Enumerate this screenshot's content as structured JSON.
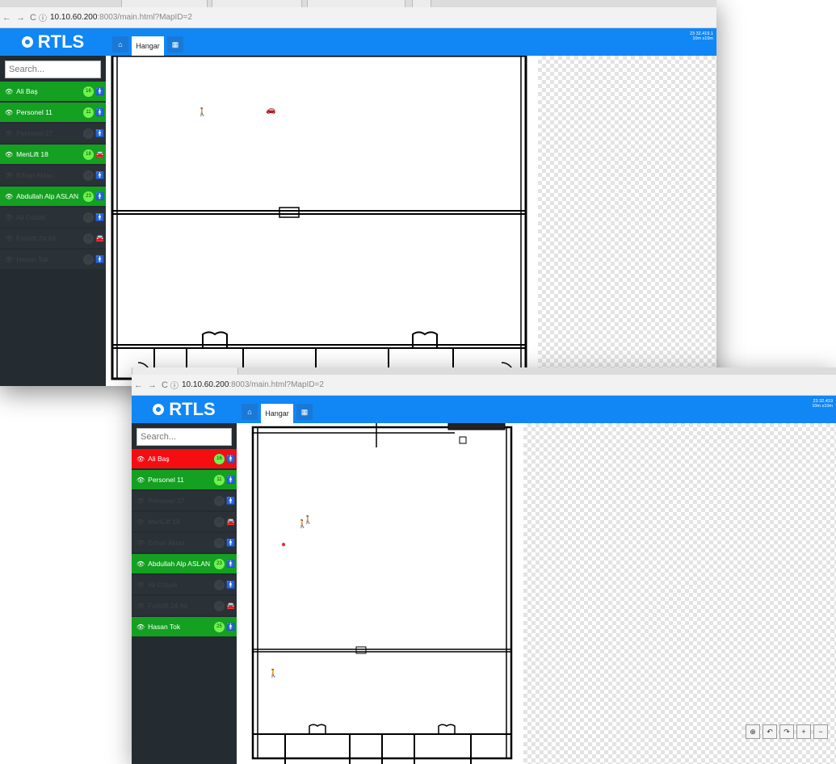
{
  "window1": {
    "url_host": "10.10.60.200",
    "url_path": ":8003/main.html?MapID=2",
    "brand": "RTLS",
    "search_placeholder": "Search...",
    "tab_home_icon": "home-icon",
    "tab_label": "Hangar",
    "tab_map_icon": "map-icon",
    "coords_line1": "23 32.419.1",
    "coords_line2": "10m x10m",
    "items": [
      {
        "name": "Ali Baş",
        "badge": "16",
        "state": "green",
        "icon": "person-icon"
      },
      {
        "name": "Personel 11",
        "badge": "11",
        "state": "green",
        "icon": "person-icon"
      },
      {
        "name": "Personel 27",
        "badge": "27",
        "state": "dark",
        "icon": "person-icon"
      },
      {
        "name": "MenLift 18",
        "badge": "18",
        "state": "green",
        "icon": "car-icon"
      },
      {
        "name": "Erhan Aktas",
        "badge": "26",
        "state": "dark",
        "icon": "person-icon"
      },
      {
        "name": "Abdullah Alp ASLAN",
        "badge": "23",
        "state": "green",
        "icon": "person-icon"
      },
      {
        "name": "Ali Ozturk",
        "badge": "22",
        "state": "dark",
        "icon": "person-icon"
      },
      {
        "name": "Forklift 24 Alt",
        "badge": "24",
        "state": "dark",
        "icon": "car-icon"
      },
      {
        "name": "Hasan Tok",
        "badge": "25",
        "state": "dark",
        "icon": "person-icon"
      }
    ]
  },
  "window2": {
    "url_host": "10.10.60.200",
    "url_path": ":8003/main.html?MapID=2",
    "brand": "RTLS",
    "search_placeholder": "Search...",
    "tab_label": "Hangar",
    "coords_line1": "23 32.419",
    "coords_line2": "10m x10m",
    "items": [
      {
        "name": "Ali Baş",
        "badge": "16",
        "state": "red",
        "icon": "person-icon"
      },
      {
        "name": "Personel 11",
        "badge": "11",
        "state": "green",
        "icon": "person-icon"
      },
      {
        "name": "Personel 27",
        "badge": "27",
        "state": "dark",
        "icon": "person-icon"
      },
      {
        "name": "MenLift 18",
        "badge": "18",
        "state": "dark",
        "icon": "car-icon"
      },
      {
        "name": "Erhan Aktas",
        "badge": "26",
        "state": "dark",
        "icon": "person-icon"
      },
      {
        "name": "Abdullah Alp ASLAN",
        "badge": "23",
        "state": "green",
        "icon": "person-icon"
      },
      {
        "name": "Ali Ozturk",
        "badge": "22",
        "state": "dark",
        "icon": "person-icon"
      },
      {
        "name": "Forklift 24 Alt",
        "badge": "24",
        "state": "dark",
        "icon": "car-icon"
      },
      {
        "name": "Hasan Tok",
        "badge": "25",
        "state": "green",
        "icon": "person-icon"
      }
    ],
    "map_controls": [
      "locate-icon",
      "rotate-left-icon",
      "rotate-right-icon",
      "zoom-in-icon",
      "zoom-out-icon"
    ],
    "map_control_glyphs": [
      "⊕",
      "↶",
      "↷",
      "+",
      "−"
    ]
  },
  "colors": {
    "brand_blue": "#1186f5",
    "active_green": "#14a021",
    "alert_red": "#f50d12",
    "sidebar": "#242c32"
  }
}
